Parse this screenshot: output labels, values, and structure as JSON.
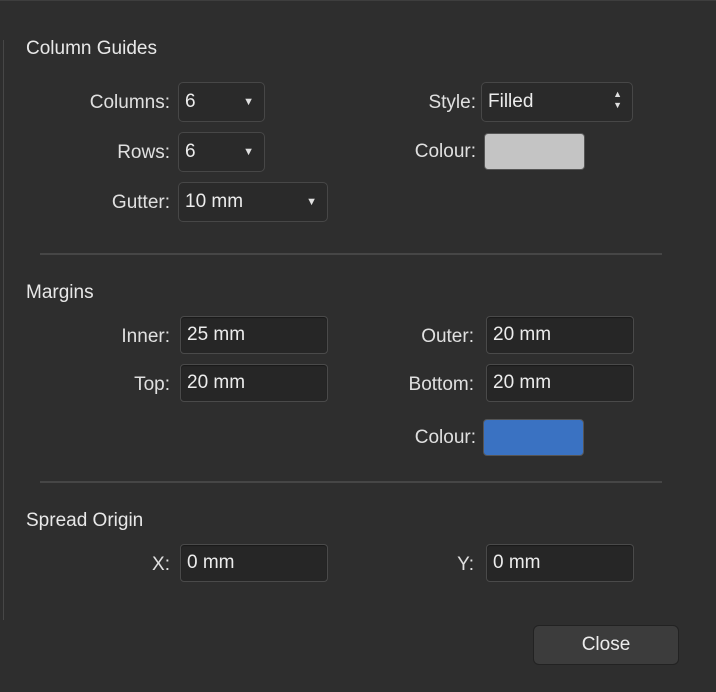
{
  "column_guides": {
    "title": "Column Guides",
    "columns_label": "Columns:",
    "columns_value": "6",
    "rows_label": "Rows:",
    "rows_value": "6",
    "gutter_label": "Gutter:",
    "gutter_value": "10 mm",
    "style_label": "Style:",
    "style_value": "Filled",
    "colour_label": "Colour:",
    "colour_value": "#c4c4c4"
  },
  "margins": {
    "title": "Margins",
    "inner_label": "Inner:",
    "inner_value": "25 mm",
    "outer_label": "Outer:",
    "outer_value": "20 mm",
    "top_label": "Top:",
    "top_value": "20 mm",
    "bottom_label": "Bottom:",
    "bottom_value": "20 mm",
    "colour_label": "Colour:",
    "colour_value": "#3a72c2"
  },
  "spread_origin": {
    "title": "Spread Origin",
    "x_label": "X:",
    "x_value": "0 mm",
    "y_label": "Y:",
    "y_value": "0 mm"
  },
  "footer": {
    "close_label": "Close"
  },
  "icons": {
    "dropdown": "chevron-down-icon",
    "stepper": "up-down-stepper-icon"
  }
}
